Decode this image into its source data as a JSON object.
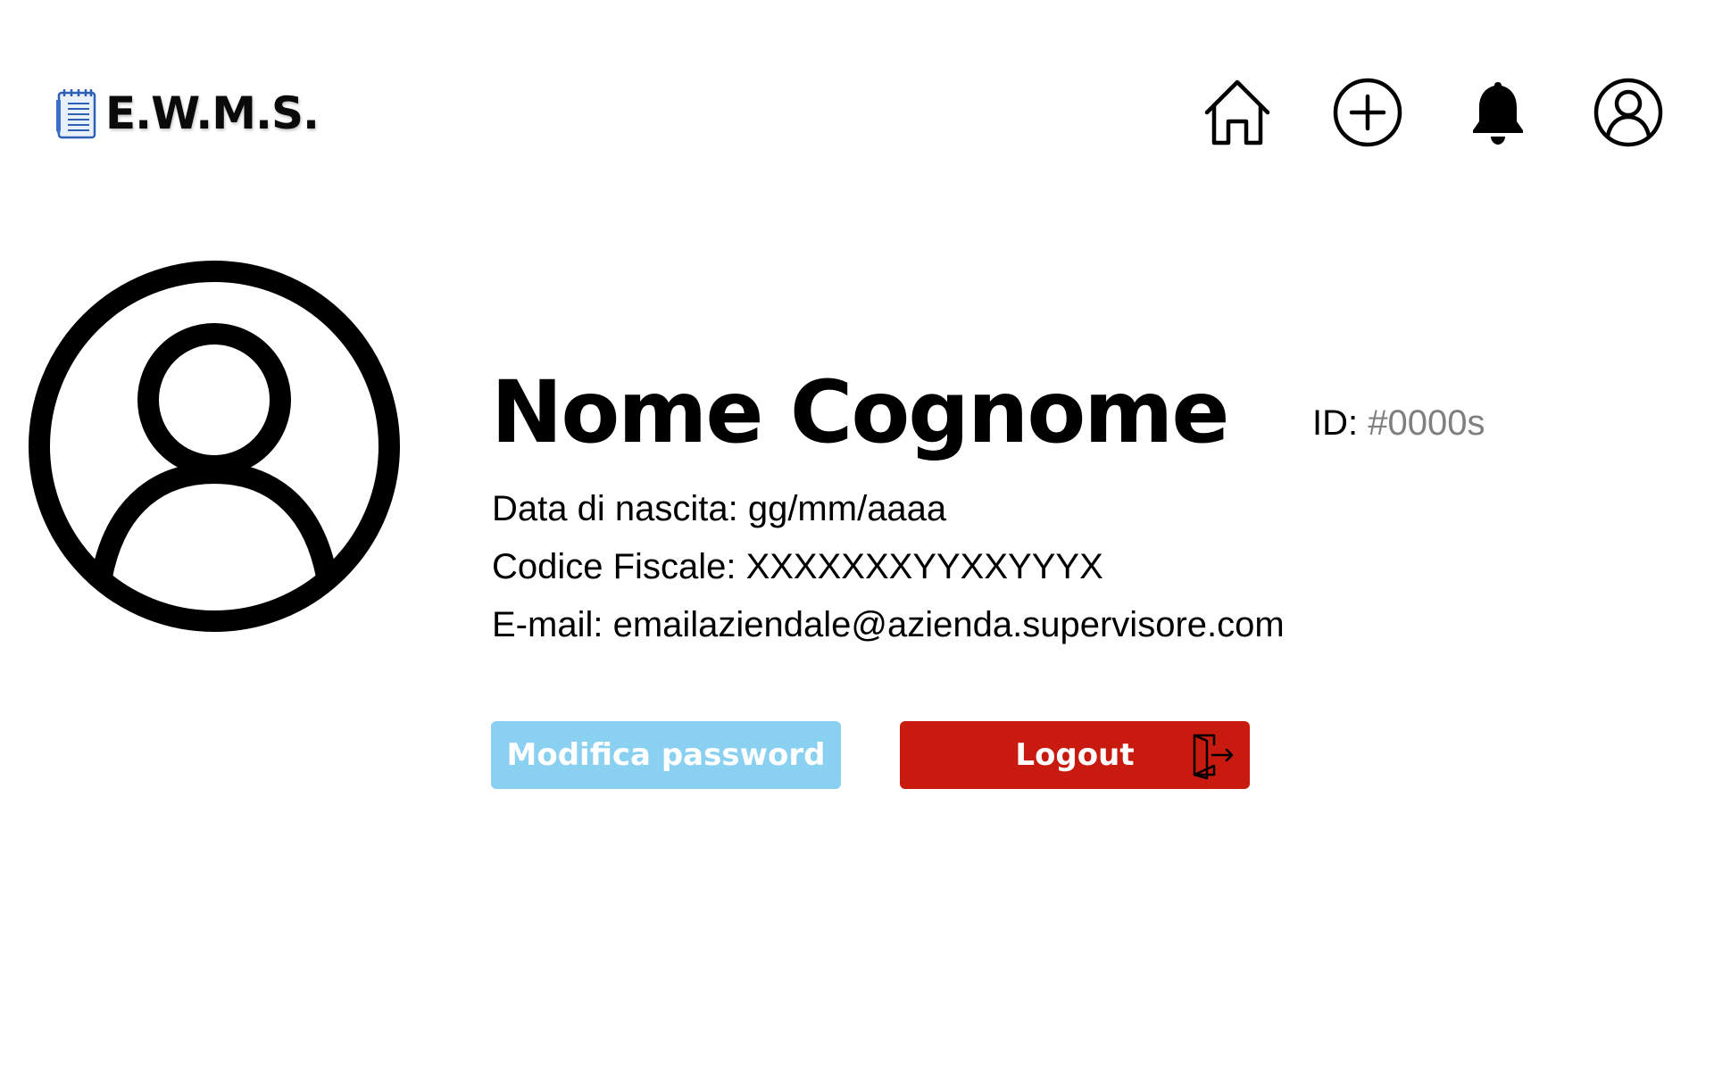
{
  "header": {
    "app_title": "E.W.M.S.",
    "logo_icon": "notepad-icon",
    "nav": [
      {
        "name": "home",
        "icon": "home-icon"
      },
      {
        "name": "add",
        "icon": "plus-circle-icon"
      },
      {
        "name": "notifications",
        "icon": "bell-icon"
      },
      {
        "name": "profile",
        "icon": "user-circle-icon"
      }
    ]
  },
  "profile": {
    "avatar_icon": "user-circle-icon",
    "name": "Nome Cognome",
    "id_label": "ID:",
    "id_value": "#0000s",
    "birth_label": "Data di nascita:",
    "birth_value": "gg/mm/aaaa",
    "fiscal_label": "Codice Fiscale:",
    "fiscal_value": "XXXXXXXYYXXYYYX",
    "email_label": "E-mail:",
    "email_value": "emailaziendale@azienda.supervisore.com"
  },
  "actions": {
    "change_password_label": "Modifica password",
    "logout_label": "Logout",
    "logout_icon": "logout-door-icon"
  },
  "colors": {
    "password_button": "#8ad0f0",
    "logout_button": "#c81a0e",
    "id_value": "#7f7f7f"
  }
}
